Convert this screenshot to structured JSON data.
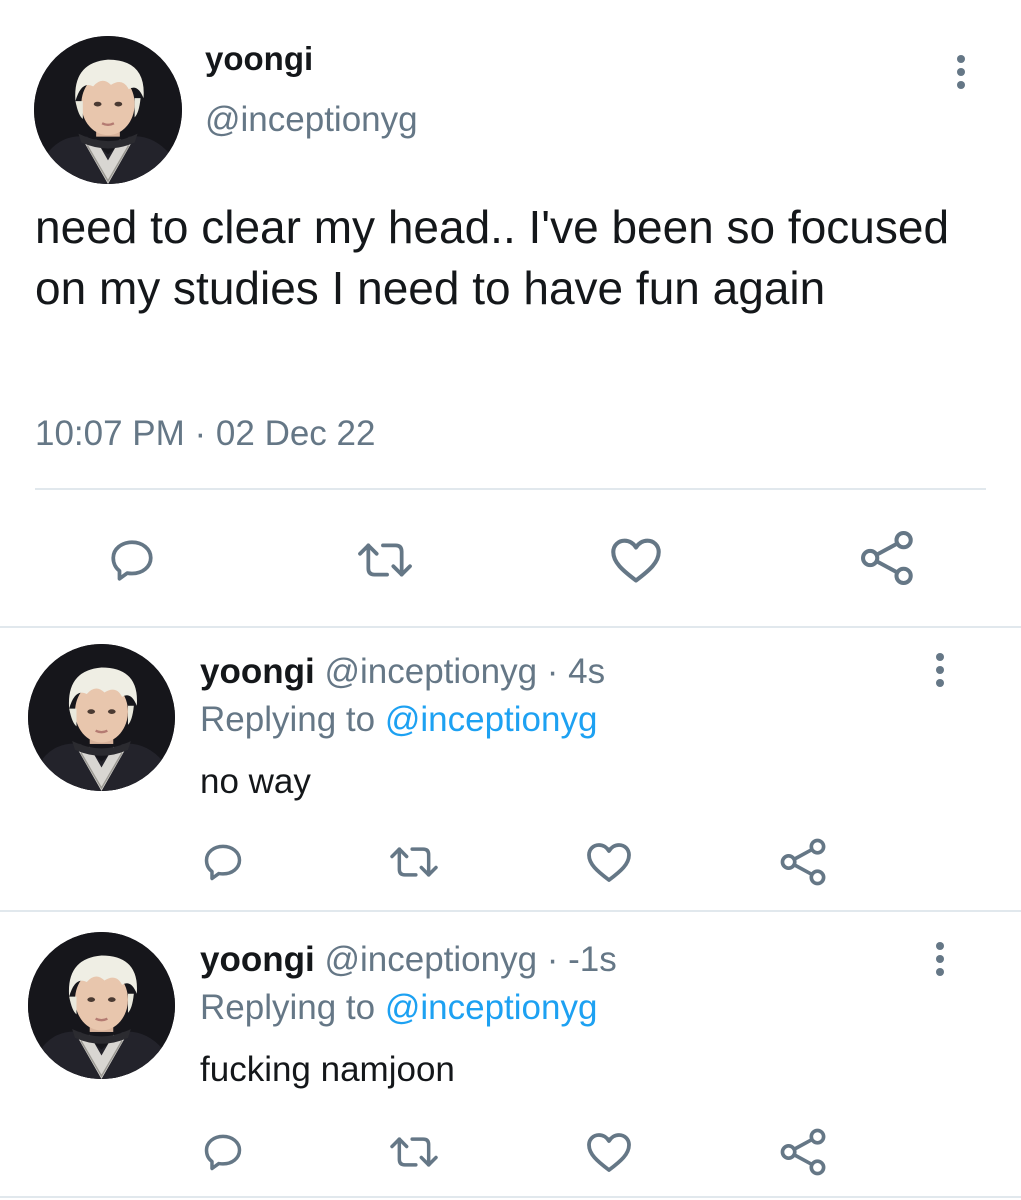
{
  "main_tweet": {
    "name": "yoongi",
    "handle": "@inceptionyg",
    "text": "need to clear my head.. I've been so focused on my studies I need to have fun again",
    "timestamp": "10:07 PM · 02 Dec 22"
  },
  "replies": [
    {
      "name": "yoongi",
      "handle_time": "@inceptionyg · 4s",
      "replying_label": "Replying to",
      "replying_mention": "@inceptionyg",
      "text": "no way"
    },
    {
      "name": "yoongi",
      "handle_time": "@inceptionyg · -1s",
      "replying_label": "Replying to",
      "replying_mention": "@inceptionyg",
      "text": "fucking namjoon"
    }
  ],
  "icons": {
    "reply": "reply-icon",
    "retweet": "retweet-icon",
    "like": "like-icon",
    "share": "share-icon",
    "more": "more-icon"
  },
  "colors": {
    "text": "#14171a",
    "secondary": "#657786",
    "link": "#1da1f2",
    "divider": "#e1e8ed"
  }
}
